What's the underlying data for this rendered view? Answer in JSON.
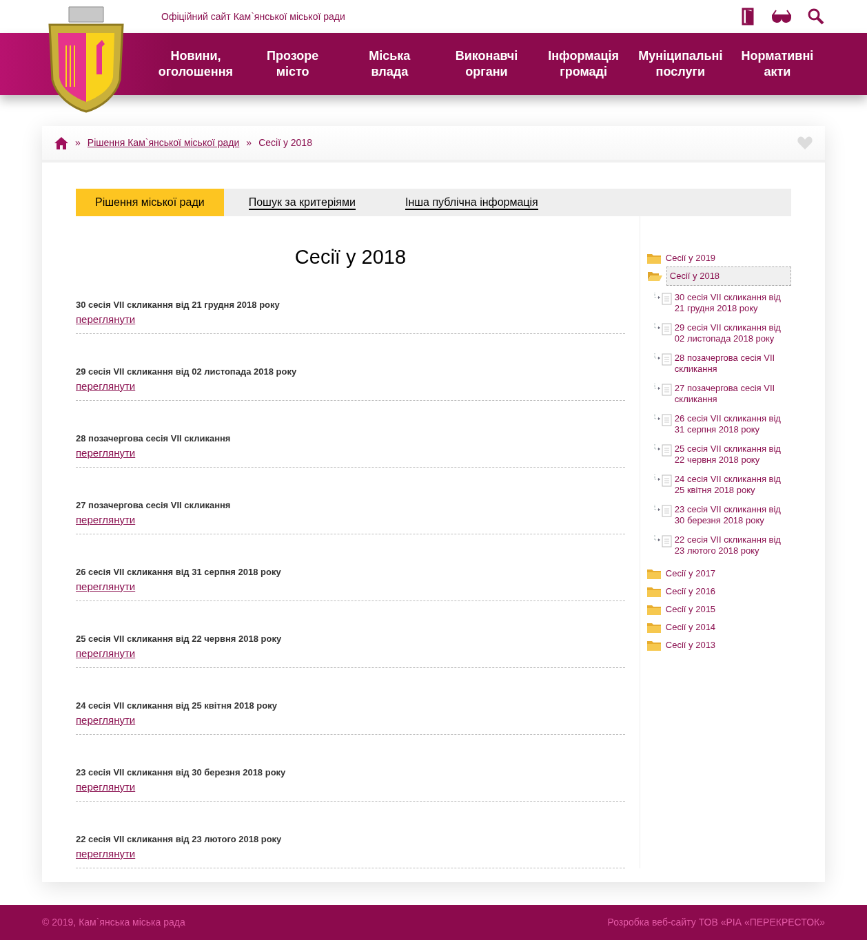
{
  "header": {
    "site_title": "Офіційний сайт Кам`янської міської ради"
  },
  "nav": [
    {
      "label": "Новини, оголошення"
    },
    {
      "label": "Прозоре місто"
    },
    {
      "label": "Міська влада"
    },
    {
      "label": "Виконавчі органи"
    },
    {
      "label": "Інформація громаді"
    },
    {
      "label": "Муніципальні послуги"
    },
    {
      "label": "Нормативні акти"
    }
  ],
  "breadcrumb": {
    "separators": [
      "»",
      "»"
    ],
    "link": "Рішення Кам`янської міської ради",
    "current": "Сесії у 2018"
  },
  "tabs": [
    {
      "label": "Рішення міської ради",
      "selected": true
    },
    {
      "label": "Пошук за критеріями",
      "selected": false
    },
    {
      "label": "Інша публічна інформація",
      "selected": false
    }
  ],
  "page_title": "Сесії у 2018",
  "sessions": [
    {
      "title": "30 сесія VII скликання від 21 грудня 2018 року",
      "link": "переглянути"
    },
    {
      "title": "29 сесія VII скликання від 02 листопада 2018 року",
      "link": "переглянути"
    },
    {
      "title": "28 позачергова сесія VII скликання",
      "link": "переглянути"
    },
    {
      "title": "27 позачергова сесія VII скликання",
      "link": "переглянути"
    },
    {
      "title": "26 сесія VII скликання від 31 серпня 2018 року",
      "link": "переглянути"
    },
    {
      "title": "25 сесія VII скликання від 22 червня 2018 року",
      "link": "переглянути"
    },
    {
      "title": "24 сесія VII скликання від 25 квітня 2018 року",
      "link": "переглянути"
    },
    {
      "title": "23 сесія VII скликання від 30 березня 2018 року",
      "link": "переглянути"
    },
    {
      "title": "22 сесія VII скликання від 23 лютого 2018 року",
      "link": "переглянути"
    }
  ],
  "tree": [
    {
      "label": "Сесії у 2019",
      "expanded": false,
      "selected": false
    },
    {
      "label": "Сесії у 2018",
      "expanded": true,
      "selected": true,
      "children": [
        {
          "label": "30 сесія VII скликання від 21 грудня 2018 року"
        },
        {
          "label": "29 сесія VII скликання від 02 листопада 2018 року"
        },
        {
          "label": "28 позачергова сесія VII скликання"
        },
        {
          "label": "27 позачергова сесія VII скликання"
        },
        {
          "label": "26 сесія VII скликання від 31 серпня 2018 року"
        },
        {
          "label": "25 сесія VII скликання від 22 червня 2018 року"
        },
        {
          "label": "24 сесія VII скликання від 25 квітня 2018 року"
        },
        {
          "label": "23 сесія VII скликання від 30 березня 2018 року"
        },
        {
          "label": "22 сесія VII скликання від 23 лютого 2018 року"
        }
      ]
    },
    {
      "label": "Сесії у 2017",
      "expanded": false,
      "selected": false
    },
    {
      "label": "Сесії у 2016",
      "expanded": false,
      "selected": false
    },
    {
      "label": "Сесії у 2015",
      "expanded": false,
      "selected": false
    },
    {
      "label": "Сесії у 2014",
      "expanded": false,
      "selected": false
    },
    {
      "label": "Сесії у 2013",
      "expanded": false,
      "selected": false
    }
  ],
  "footer": {
    "copyright": "© 2019, Кам`янська міська рада",
    "developer": "Розробка веб-сайту ТОВ «РІА «ПЕРЕКРЕСТОК»"
  }
}
